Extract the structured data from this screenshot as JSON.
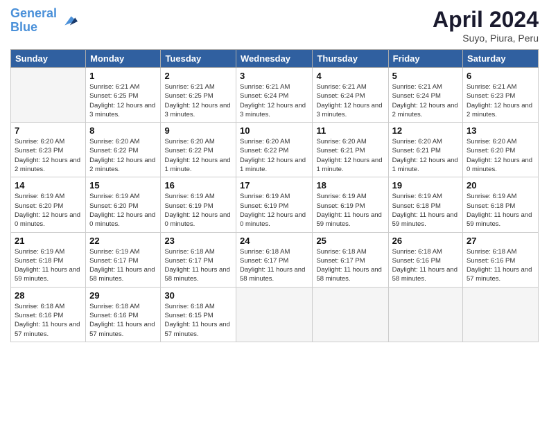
{
  "logo": {
    "line1": "General",
    "line2": "Blue"
  },
  "header": {
    "title": "April 2024",
    "subtitle": "Suyo, Piura, Peru"
  },
  "columns": [
    "Sunday",
    "Monday",
    "Tuesday",
    "Wednesday",
    "Thursday",
    "Friday",
    "Saturday"
  ],
  "weeks": [
    [
      {
        "day": "",
        "sunrise": "",
        "sunset": "",
        "daylight": ""
      },
      {
        "day": "1",
        "sunrise": "Sunrise: 6:21 AM",
        "sunset": "Sunset: 6:25 PM",
        "daylight": "Daylight: 12 hours and 3 minutes."
      },
      {
        "day": "2",
        "sunrise": "Sunrise: 6:21 AM",
        "sunset": "Sunset: 6:25 PM",
        "daylight": "Daylight: 12 hours and 3 minutes."
      },
      {
        "day": "3",
        "sunrise": "Sunrise: 6:21 AM",
        "sunset": "Sunset: 6:24 PM",
        "daylight": "Daylight: 12 hours and 3 minutes."
      },
      {
        "day": "4",
        "sunrise": "Sunrise: 6:21 AM",
        "sunset": "Sunset: 6:24 PM",
        "daylight": "Daylight: 12 hours and 3 minutes."
      },
      {
        "day": "5",
        "sunrise": "Sunrise: 6:21 AM",
        "sunset": "Sunset: 6:24 PM",
        "daylight": "Daylight: 12 hours and 2 minutes."
      },
      {
        "day": "6",
        "sunrise": "Sunrise: 6:21 AM",
        "sunset": "Sunset: 6:23 PM",
        "daylight": "Daylight: 12 hours and 2 minutes."
      }
    ],
    [
      {
        "day": "7",
        "sunrise": "Sunrise: 6:20 AM",
        "sunset": "Sunset: 6:23 PM",
        "daylight": "Daylight: 12 hours and 2 minutes."
      },
      {
        "day": "8",
        "sunrise": "Sunrise: 6:20 AM",
        "sunset": "Sunset: 6:22 PM",
        "daylight": "Daylight: 12 hours and 2 minutes."
      },
      {
        "day": "9",
        "sunrise": "Sunrise: 6:20 AM",
        "sunset": "Sunset: 6:22 PM",
        "daylight": "Daylight: 12 hours and 1 minute."
      },
      {
        "day": "10",
        "sunrise": "Sunrise: 6:20 AM",
        "sunset": "Sunset: 6:22 PM",
        "daylight": "Daylight: 12 hours and 1 minute."
      },
      {
        "day": "11",
        "sunrise": "Sunrise: 6:20 AM",
        "sunset": "Sunset: 6:21 PM",
        "daylight": "Daylight: 12 hours and 1 minute."
      },
      {
        "day": "12",
        "sunrise": "Sunrise: 6:20 AM",
        "sunset": "Sunset: 6:21 PM",
        "daylight": "Daylight: 12 hours and 1 minute."
      },
      {
        "day": "13",
        "sunrise": "Sunrise: 6:20 AM",
        "sunset": "Sunset: 6:20 PM",
        "daylight": "Daylight: 12 hours and 0 minutes."
      }
    ],
    [
      {
        "day": "14",
        "sunrise": "Sunrise: 6:19 AM",
        "sunset": "Sunset: 6:20 PM",
        "daylight": "Daylight: 12 hours and 0 minutes."
      },
      {
        "day": "15",
        "sunrise": "Sunrise: 6:19 AM",
        "sunset": "Sunset: 6:20 PM",
        "daylight": "Daylight: 12 hours and 0 minutes."
      },
      {
        "day": "16",
        "sunrise": "Sunrise: 6:19 AM",
        "sunset": "Sunset: 6:19 PM",
        "daylight": "Daylight: 12 hours and 0 minutes."
      },
      {
        "day": "17",
        "sunrise": "Sunrise: 6:19 AM",
        "sunset": "Sunset: 6:19 PM",
        "daylight": "Daylight: 12 hours and 0 minutes."
      },
      {
        "day": "18",
        "sunrise": "Sunrise: 6:19 AM",
        "sunset": "Sunset: 6:19 PM",
        "daylight": "Daylight: 11 hours and 59 minutes."
      },
      {
        "day": "19",
        "sunrise": "Sunrise: 6:19 AM",
        "sunset": "Sunset: 6:18 PM",
        "daylight": "Daylight: 11 hours and 59 minutes."
      },
      {
        "day": "20",
        "sunrise": "Sunrise: 6:19 AM",
        "sunset": "Sunset: 6:18 PM",
        "daylight": "Daylight: 11 hours and 59 minutes."
      }
    ],
    [
      {
        "day": "21",
        "sunrise": "Sunrise: 6:19 AM",
        "sunset": "Sunset: 6:18 PM",
        "daylight": "Daylight: 11 hours and 59 minutes."
      },
      {
        "day": "22",
        "sunrise": "Sunrise: 6:19 AM",
        "sunset": "Sunset: 6:17 PM",
        "daylight": "Daylight: 11 hours and 58 minutes."
      },
      {
        "day": "23",
        "sunrise": "Sunrise: 6:18 AM",
        "sunset": "Sunset: 6:17 PM",
        "daylight": "Daylight: 11 hours and 58 minutes."
      },
      {
        "day": "24",
        "sunrise": "Sunrise: 6:18 AM",
        "sunset": "Sunset: 6:17 PM",
        "daylight": "Daylight: 11 hours and 58 minutes."
      },
      {
        "day": "25",
        "sunrise": "Sunrise: 6:18 AM",
        "sunset": "Sunset: 6:17 PM",
        "daylight": "Daylight: 11 hours and 58 minutes."
      },
      {
        "day": "26",
        "sunrise": "Sunrise: 6:18 AM",
        "sunset": "Sunset: 6:16 PM",
        "daylight": "Daylight: 11 hours and 58 minutes."
      },
      {
        "day": "27",
        "sunrise": "Sunrise: 6:18 AM",
        "sunset": "Sunset: 6:16 PM",
        "daylight": "Daylight: 11 hours and 57 minutes."
      }
    ],
    [
      {
        "day": "28",
        "sunrise": "Sunrise: 6:18 AM",
        "sunset": "Sunset: 6:16 PM",
        "daylight": "Daylight: 11 hours and 57 minutes."
      },
      {
        "day": "29",
        "sunrise": "Sunrise: 6:18 AM",
        "sunset": "Sunset: 6:16 PM",
        "daylight": "Daylight: 11 hours and 57 minutes."
      },
      {
        "day": "30",
        "sunrise": "Sunrise: 6:18 AM",
        "sunset": "Sunset: 6:15 PM",
        "daylight": "Daylight: 11 hours and 57 minutes."
      },
      {
        "day": "",
        "sunrise": "",
        "sunset": "",
        "daylight": ""
      },
      {
        "day": "",
        "sunrise": "",
        "sunset": "",
        "daylight": ""
      },
      {
        "day": "",
        "sunrise": "",
        "sunset": "",
        "daylight": ""
      },
      {
        "day": "",
        "sunrise": "",
        "sunset": "",
        "daylight": ""
      }
    ]
  ]
}
